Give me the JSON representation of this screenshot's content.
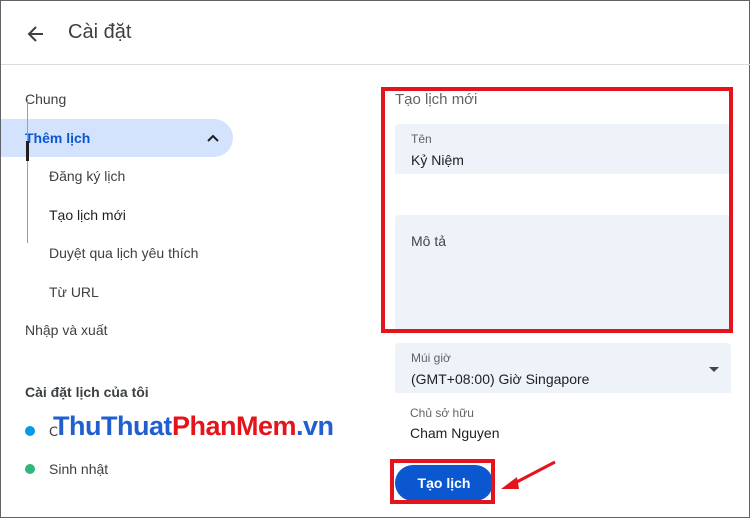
{
  "header": {
    "title": "Cài đặt"
  },
  "sidebar": {
    "items": [
      {
        "label": "Chung"
      },
      {
        "label": "Thêm lịch"
      },
      {
        "label": "Đăng ký lịch"
      },
      {
        "label": "Tạo lịch mới"
      },
      {
        "label": "Duyệt qua lịch yêu thích"
      },
      {
        "label": "Từ URL"
      },
      {
        "label": "Nhập và xuất"
      }
    ],
    "my_calendars_title": "Cài đặt lịch của tôi",
    "my_calendars": [
      {
        "label": "C",
        "color": "#039be5"
      },
      {
        "label": "Sinh nhật",
        "color": "#33b679"
      }
    ]
  },
  "form": {
    "title": "Tạo lịch mới",
    "name_label": "Tên",
    "name_value": "Kỷ Niệm",
    "description_label": "Mô tả",
    "timezone_label": "Múi giờ",
    "timezone_value": "(GMT+08:00) Giờ Singapore",
    "owner_label": "Chủ sở hữu",
    "owner_value": "Cham Nguyen",
    "create_button": "Tạo lịch"
  },
  "watermark": {
    "part1": "ThuThuat",
    "part2": "PhanMem",
    "part3": ".vn"
  },
  "colors": {
    "accent": "#0b57d0",
    "highlight": "#e3141b",
    "active_bg": "#d3e3fd"
  }
}
